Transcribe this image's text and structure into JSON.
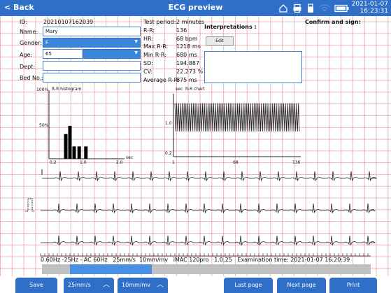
{
  "header": {
    "back_label": "< Back",
    "title": "ECG preview",
    "date": "2021-01-07",
    "time": "16:23:31",
    "status_icons": [
      "home-icon",
      "printer-icon",
      "usb-icon",
      "wifi-icon",
      "battery-icon"
    ]
  },
  "patient": {
    "id_label": "ID:",
    "id_value": "20210107162039",
    "name_label": "Name:",
    "name_value": "Mary",
    "gender_label": "Gender:",
    "gender_value": "F",
    "age_label": "Age:",
    "age_value": "65",
    "dept_label": "Dept:",
    "dept_value": "",
    "bed_label": "Bed No.:",
    "bed_value": ""
  },
  "measurements": [
    {
      "label": "Test period:",
      "value": "2 minutes"
    },
    {
      "label": "R-R:",
      "value": "136"
    },
    {
      "label": "HR:",
      "value": "68 bpm"
    },
    {
      "label": "Max R-R:",
      "value": "1218 ms"
    },
    {
      "label": "Min R-R:",
      "value": "680 ms"
    },
    {
      "label": "SD:",
      "value": "194.887"
    },
    {
      "label": "CV:",
      "value": "22.273 %"
    },
    {
      "label": "Average R-R:",
      "value": "875 ms"
    }
  ],
  "interpretations": {
    "title": "Interpretations :",
    "edit_label": "Edit",
    "text": ""
  },
  "confirm_label": "Confirm and sign:",
  "histogram_chart": {
    "type": "bar",
    "title": "R-R histogram",
    "xlabel": "sec",
    "y_ticks": [
      "100%",
      "50%"
    ],
    "x_ticks": [
      "0.2",
      "1.0",
      "2.0"
    ],
    "xlim": [
      0.2,
      2.0
    ],
    "ylim": [
      0,
      100
    ],
    "x": [
      0.6,
      0.7,
      0.8,
      0.92,
      1.08
    ],
    "values": [
      36,
      48,
      18,
      18,
      18
    ]
  },
  "rr_chart": {
    "type": "line",
    "title": "R-R chart",
    "ylabel": "sec",
    "y_ticks": [
      "1.0",
      "0.2"
    ],
    "x_ticks": [
      "1",
      "68",
      "136"
    ],
    "xlim": [
      1,
      136
    ],
    "ylim": [
      0.2,
      1.4
    ],
    "values_note": "alternating R-R intervals between 0.68 and 1.22 sec"
  },
  "ecg": {
    "calibration_marker": true,
    "strips": 3
  },
  "footer_info": {
    "filters": "0.60Hz -25Hz - AC 60Hz",
    "speed": "25mm/s",
    "gain": "10mm/mv",
    "device": "iMAC 120pro",
    "version": "1.0.25",
    "exam_time": "Examination time: 2021-01-07 16:20:39"
  },
  "bottom_buttons": {
    "save": "Save",
    "speed": "25mm/s",
    "gain": "10mm/mv",
    "last_page": "Last page",
    "next_page": "Next page",
    "print": "Print"
  },
  "colors": {
    "accent": "#2f6fc7",
    "grid": "#e27882",
    "trace": "#222222",
    "scroll_thumb": "#4a90e2"
  }
}
